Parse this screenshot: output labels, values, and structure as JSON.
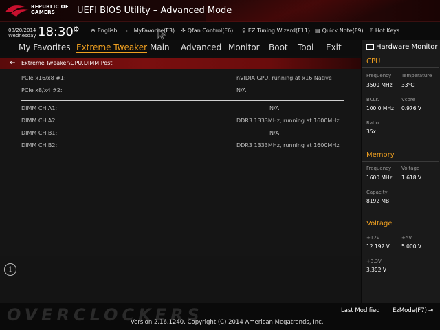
{
  "header": {
    "brand_line1": "REPUBLIC OF",
    "brand_line2": "GAMERS",
    "title": "UEFI BIOS Utility – Advanced Mode"
  },
  "clock": {
    "date": "08/20/2014",
    "day": "Wednesday",
    "time": "18:30"
  },
  "toolbar": {
    "english": "English",
    "myfavorite": "MyFavorite(F3)",
    "qfan": "Qfan Control(F6)",
    "ez_tuning": "EZ Tuning Wizard(F11)",
    "quick_note": "Quick Note(F9)",
    "hot_keys": "Hot Keys"
  },
  "nav": {
    "tabs": [
      {
        "label": "My Favorites"
      },
      {
        "label": "Extreme Tweaker"
      },
      {
        "label": "Main"
      },
      {
        "label": "Advanced"
      },
      {
        "label": "Monitor"
      },
      {
        "label": "Boot"
      },
      {
        "label": "Tool"
      },
      {
        "label": "Exit"
      }
    ],
    "active": "Extreme Tweaker"
  },
  "breadcrumb": "Extreme Tweaker\\GPU.DIMM Post",
  "items": [
    {
      "label": "PCIe x16/x8 #1:",
      "value": "nVIDIA GPU, running at x16 Native"
    },
    {
      "label": "PCIe x8/x4 #2:",
      "value": "N/A"
    },
    {
      "label": "DIMM CH.A1:",
      "value": "N/A"
    },
    {
      "label": "DIMM CH.A2:",
      "value": "DDR3 1333MHz, running at 1600MHz"
    },
    {
      "label": "DIMM CH.B1:",
      "value": "N/A"
    },
    {
      "label": "DIMM CH.B2:",
      "value": "DDR3 1333MHz, running at 1600MHz"
    }
  ],
  "hw": {
    "title": "Hardware Monitor",
    "cpu": {
      "section": "CPU",
      "frequency_label": "Frequency",
      "frequency": "3500 MHz",
      "temperature_label": "Temperature",
      "temperature": "33°C",
      "bclk_label": "BCLK",
      "bclk": "100.0 MHz",
      "vcore_label": "Vcore",
      "vcore": "0.976 V",
      "ratio_label": "Ratio",
      "ratio": "35x"
    },
    "memory": {
      "section": "Memory",
      "frequency_label": "Frequency",
      "frequency": "1600 MHz",
      "voltage_label": "Voltage",
      "voltage": "1.618 V",
      "capacity_label": "Capacity",
      "capacity": "8192 MB"
    },
    "voltage": {
      "section": "Voltage",
      "v12_label": "+12V",
      "v12": "12.192 V",
      "v5_label": "+5V",
      "v5": "5.000 V",
      "v33_label": "+3.3V",
      "v33": "3.392 V"
    }
  },
  "footer": {
    "last_modified": "Last Modified",
    "ezmode": "EzMode(F7)",
    "version": "Version 2.16.1240. Copyright (C) 2014 American Megatrends, Inc.",
    "watermark": "OVERCLOCKERS"
  }
}
